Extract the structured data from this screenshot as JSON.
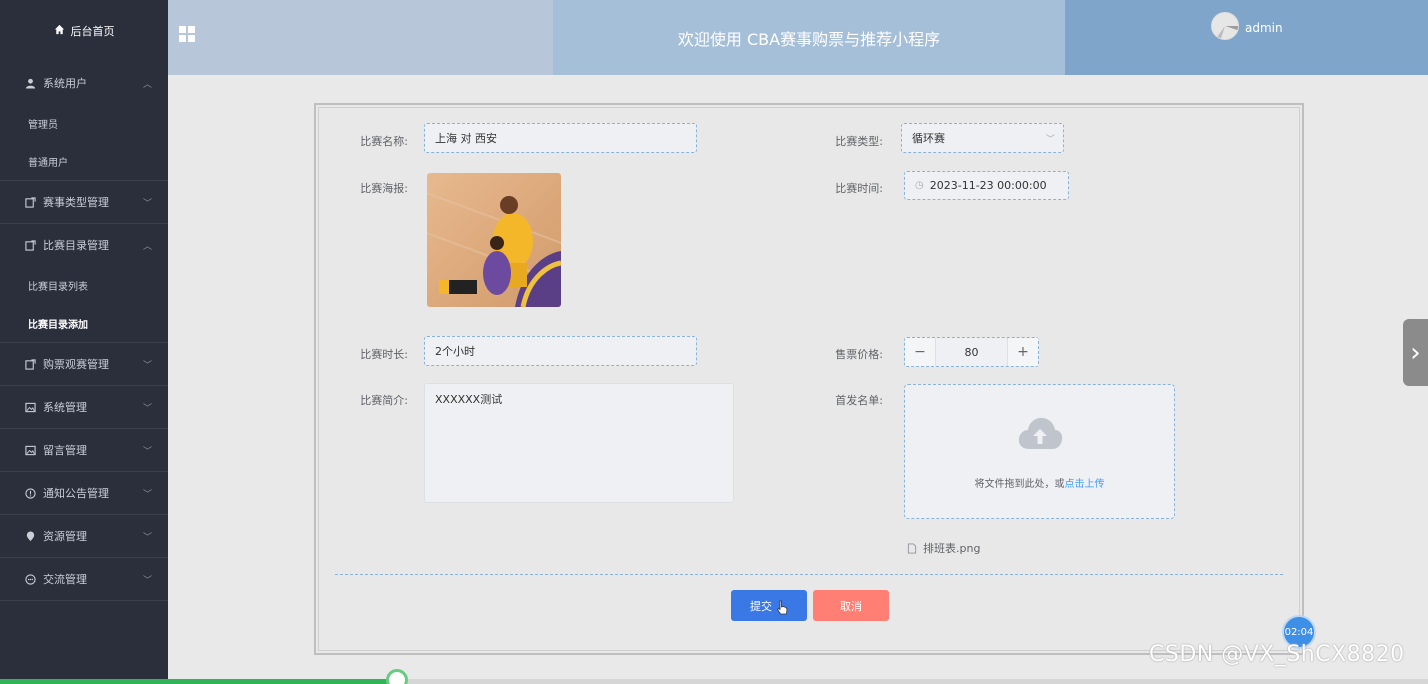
{
  "sidebar": {
    "home": "后台首页",
    "groups": [
      {
        "label": "系统用户",
        "icon": "user-icon",
        "expanded": true,
        "items": [
          "管理员",
          "普通用户"
        ]
      },
      {
        "label": "赛事类型管理",
        "icon": "edit-icon",
        "expanded": false,
        "items": []
      },
      {
        "label": "比赛目录管理",
        "icon": "edit-icon",
        "expanded": true,
        "items": [
          "比赛目录列表",
          "比赛目录添加"
        ]
      },
      {
        "label": "购票观赛管理",
        "icon": "edit-icon",
        "expanded": false,
        "items": []
      },
      {
        "label": "系统管理",
        "icon": "picture-icon",
        "expanded": false,
        "items": []
      },
      {
        "label": "留言管理",
        "icon": "picture-icon",
        "expanded": false,
        "items": []
      },
      {
        "label": "通知公告管理",
        "icon": "info-icon",
        "expanded": false,
        "items": []
      },
      {
        "label": "资源管理",
        "icon": "location-icon",
        "expanded": false,
        "items": []
      },
      {
        "label": "交流管理",
        "icon": "chat-icon",
        "expanded": false,
        "items": []
      }
    ],
    "active_item": "比赛目录添加"
  },
  "header": {
    "title": "欢迎使用 CBA赛事购票与推荐小程序",
    "username": "admin"
  },
  "form": {
    "name_label": "比赛名称:",
    "name_value": "上海 对 西安",
    "type_label": "比赛类型:",
    "type_value": "循环赛",
    "poster_label": "比赛海报:",
    "time_label": "比赛时间:",
    "time_value": "2023-11-23 00:00:00",
    "duration_label": "比赛时长:",
    "duration_value": "2个小时",
    "price_label": "售票价格:",
    "price_value": "80",
    "intro_label": "比赛简介:",
    "intro_value": "XXXXXX测试",
    "list_label": "首发名单:",
    "upload_text": "将文件拖到此处，或",
    "upload_link": "点击上传",
    "file_name": "排班表.png",
    "submit_label": "提交",
    "cancel_label": "取消"
  },
  "overlay": {
    "timer": "02:04",
    "watermark": "CSDN @VX_ShCX8820",
    "progress": 0.278
  },
  "colors": {
    "sidebar_bg": "#2b2f3c",
    "submit": "#3a78e6",
    "cancel": "#ff7f75",
    "link": "#409eff"
  }
}
